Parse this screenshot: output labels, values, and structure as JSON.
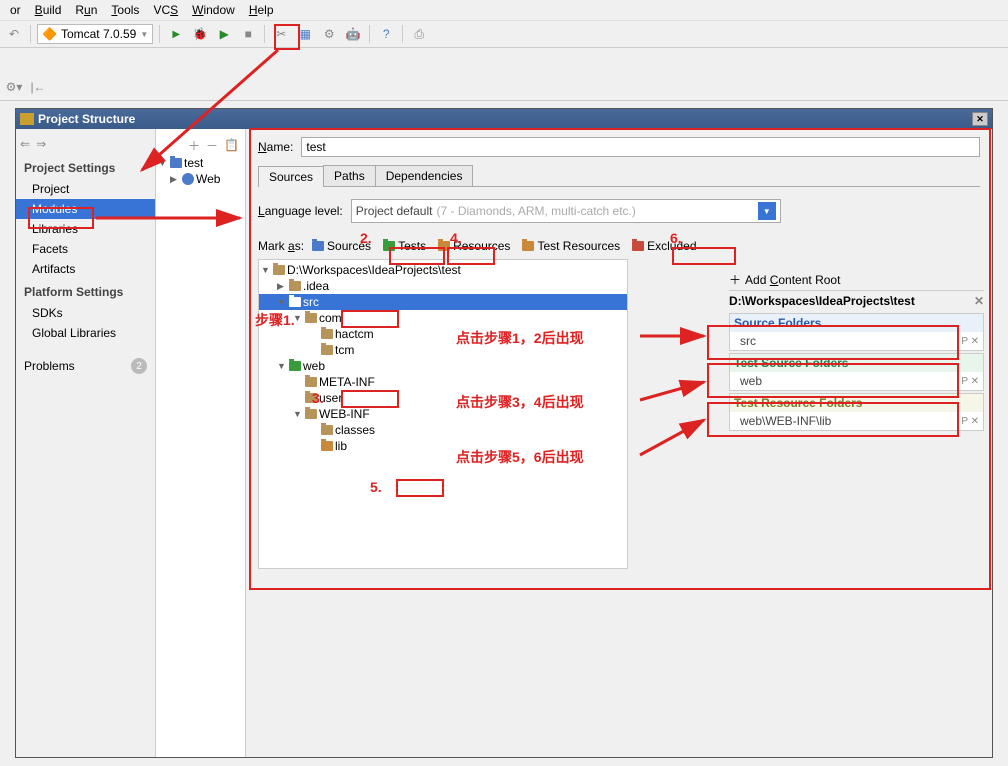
{
  "menubar": [
    "or",
    "Build",
    "Run",
    "Tools",
    "VCS",
    "Window",
    "Help"
  ],
  "toolbar": {
    "run_config": "Tomcat 7.0.59"
  },
  "dialog": {
    "title": "Project Structure",
    "nav": {
      "section1_title": "Project Settings",
      "items1": [
        "Project",
        "Modules",
        "Libraries",
        "Facets",
        "Artifacts"
      ],
      "section2_title": "Platform Settings",
      "items2": [
        "SDKs",
        "Global Libraries"
      ],
      "problems": "Problems",
      "problems_count": "2"
    },
    "tree": {
      "root": "test",
      "child": "Web"
    },
    "content": {
      "name_label": "Name:",
      "name_value": "test",
      "tabs": [
        "Sources",
        "Paths",
        "Dependencies"
      ],
      "lang_label": "Language level:",
      "lang_value": "Project default",
      "lang_hint": "(7 - Diamonds, ARM, multi-catch etc.)",
      "mark_label": "Mark as:",
      "mark_buttons": [
        "Sources",
        "Tests",
        "Resources",
        "Test Resources",
        "Excluded"
      ],
      "src_tree": {
        "root_path": "D:\\Workspaces\\IdeaProjects\\test",
        "nodes": [
          {
            "depth": 1,
            "arrow": "▶",
            "icon": "brown",
            "label": ".idea"
          },
          {
            "depth": 1,
            "arrow": "▼",
            "icon": "blue",
            "label": "src",
            "sel": true
          },
          {
            "depth": 2,
            "arrow": "▼",
            "icon": "brown",
            "label": "com"
          },
          {
            "depth": 3,
            "arrow": "",
            "icon": "brown",
            "label": "hactcm"
          },
          {
            "depth": 3,
            "arrow": "",
            "icon": "brown",
            "label": "tcm"
          },
          {
            "depth": 1,
            "arrow": "▼",
            "icon": "green",
            "label": "web"
          },
          {
            "depth": 2,
            "arrow": "",
            "icon": "brown",
            "label": "META-INF"
          },
          {
            "depth": 2,
            "arrow": "",
            "icon": "brown",
            "label": "user"
          },
          {
            "depth": 2,
            "arrow": "▼",
            "icon": "brown",
            "label": "WEB-INF"
          },
          {
            "depth": 3,
            "arrow": "",
            "icon": "brown",
            "label": "classes"
          },
          {
            "depth": 3,
            "arrow": "",
            "icon": "orange",
            "label": "lib"
          }
        ]
      },
      "roots": {
        "add_label": "Add Content Root",
        "path": "D:\\Workspaces\\IdeaProjects\\test",
        "sections": [
          {
            "cls": "blue",
            "title": "Source Folders",
            "item": "src"
          },
          {
            "cls": "green",
            "title": "Test Source Folders",
            "item": "web"
          },
          {
            "cls": "olive",
            "title": "Test Resource Folders",
            "item": "web\\WEB-INF\\lib"
          }
        ]
      }
    }
  },
  "annotations": {
    "step1": "步骤1.",
    "step3": "3.",
    "step5": "5.",
    "step2": "2.",
    "step4": "4.",
    "step6": "6.",
    "note12": "点击步骤1，2后出现",
    "note34": "点击步骤3，4后出现",
    "note56": "点击步骤5，6后出现"
  }
}
